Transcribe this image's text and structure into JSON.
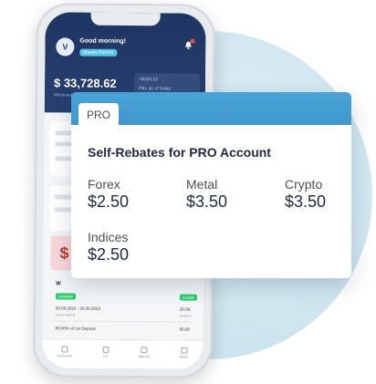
{
  "phone": {
    "avatar_initial": "V",
    "greeting": "Good morning!",
    "badge": "Master Partner",
    "balance": "$ 33,728.62",
    "balance_caption": "Withdrawable amount",
    "mini_card_line1": "+$105.12",
    "mini_card_line2": "P&L as of today",
    "pink_glyph": "$",
    "section_title": "W",
    "pill_left": "Available",
    "pill_right": "Avaible",
    "row1_date": "20.08.2023 - 30.09.2023",
    "row1_sub": "Comm Period",
    "row1_right": "20.08.",
    "row1_right_sub": "Comm P",
    "row2_text": "50.00% of 1st Deposit",
    "row2_right": "50.00",
    "tabs": [
      "Accounts",
      "LE",
      "Market",
      "More"
    ]
  },
  "rebate_card": {
    "tab_label": "PRO",
    "title": "Self-Rebates for PRO Account",
    "items": [
      {
        "label": "Forex",
        "value": "$2.50"
      },
      {
        "label": "Metal",
        "value": "$3.50"
      },
      {
        "label": "Crypto",
        "value": "$3.50"
      },
      {
        "label": "Indices",
        "value": "$2.50"
      }
    ]
  },
  "colors": {
    "header_navy": "#1f3563",
    "accent_blue": "#4aa3d6",
    "background_circle": "#cfe6ef",
    "available_green": "#2ecc71"
  }
}
